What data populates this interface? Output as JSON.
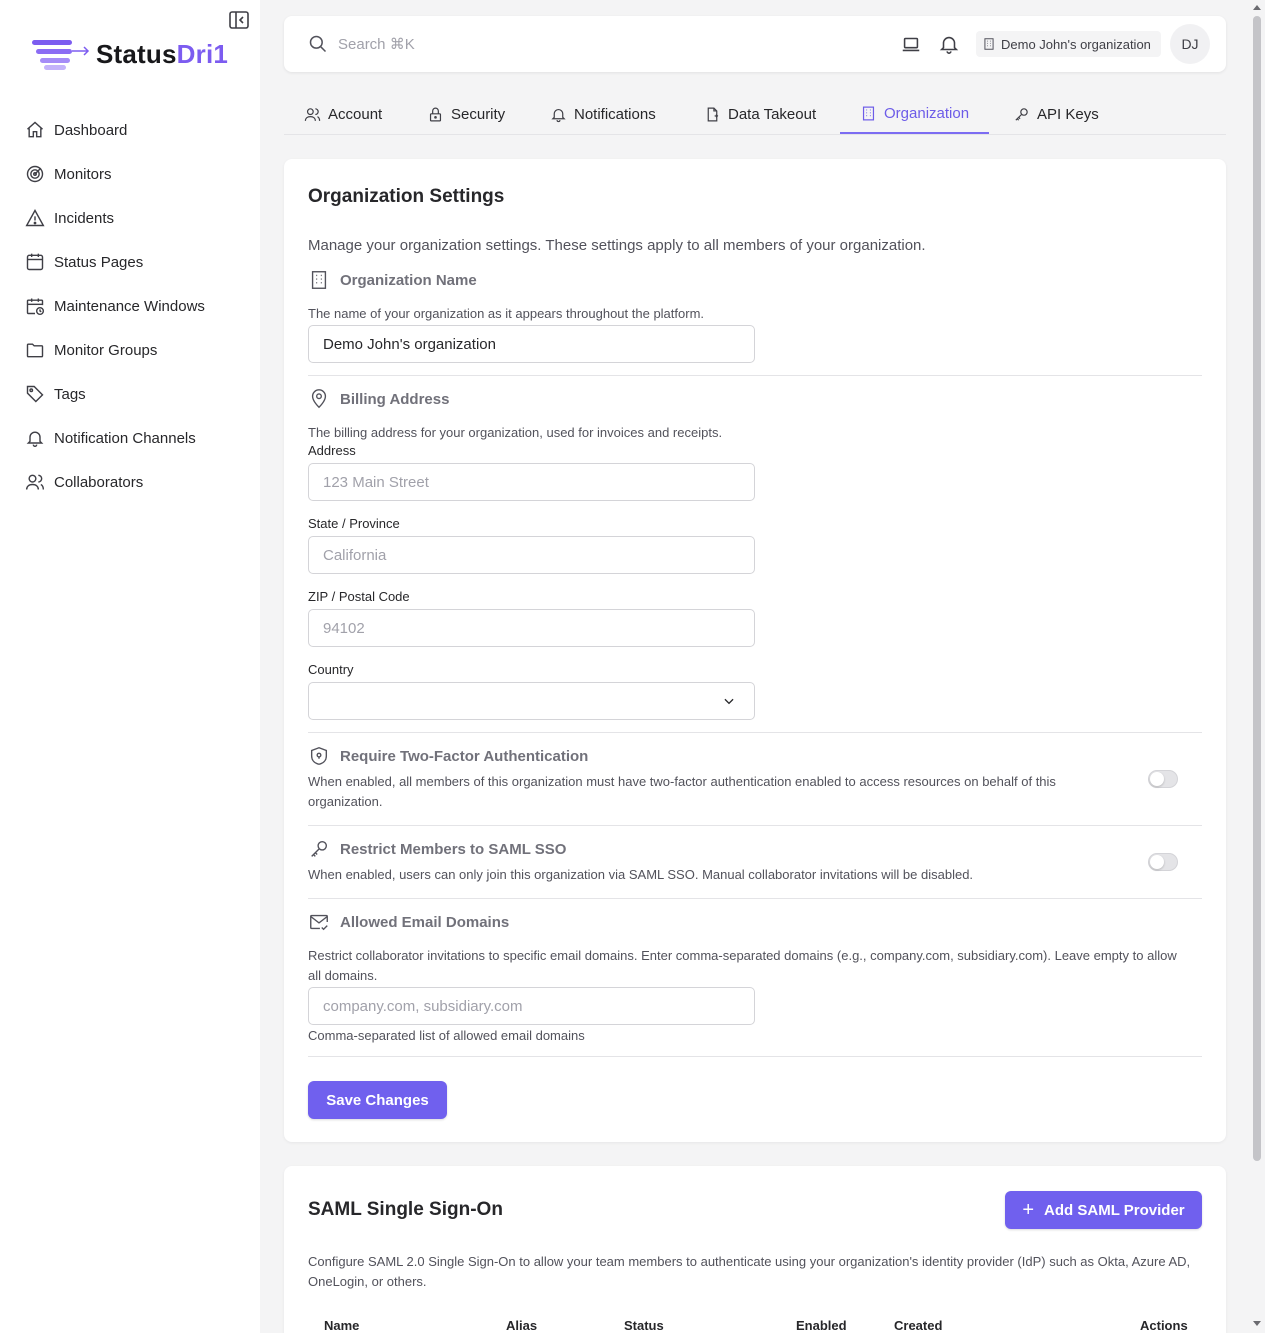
{
  "brand": {
    "name_part1": "Status",
    "name_part2": "Dri1",
    "accent_color": "#7c5cf0"
  },
  "sidebar": {
    "items": [
      {
        "label": "Dashboard",
        "icon": "home-icon"
      },
      {
        "label": "Monitors",
        "icon": "radar-icon"
      },
      {
        "label": "Incidents",
        "icon": "warning-icon"
      },
      {
        "label": "Status Pages",
        "icon": "page-icon"
      },
      {
        "label": "Maintenance Windows",
        "icon": "calendar-clock-icon"
      },
      {
        "label": "Monitor Groups",
        "icon": "folder-icon"
      },
      {
        "label": "Tags",
        "icon": "tag-icon"
      },
      {
        "label": "Notification Channels",
        "icon": "bell-icon"
      },
      {
        "label": "Collaborators",
        "icon": "users-icon"
      }
    ]
  },
  "header": {
    "search_placeholder": "Search ⌘K",
    "org_name": "Demo John's organization",
    "avatar_initials": "DJ"
  },
  "tabs": [
    {
      "label": "Account",
      "icon": "user-icon",
      "active": false
    },
    {
      "label": "Security",
      "icon": "lock-icon",
      "active": false
    },
    {
      "label": "Notifications",
      "icon": "bell-icon",
      "active": false
    },
    {
      "label": "Data Takeout",
      "icon": "file-export-icon",
      "active": false
    },
    {
      "label": "Organization",
      "icon": "building-icon",
      "active": true
    },
    {
      "label": "API Keys",
      "icon": "key-icon",
      "active": false
    }
  ],
  "org_settings": {
    "title": "Organization Settings",
    "description": "Manage your organization settings. These settings apply to all members of your organization.",
    "name_section": {
      "heading": "Organization Name",
      "help": "The name of your organization as it appears throughout the platform.",
      "value": "Demo John's organization"
    },
    "billing": {
      "heading": "Billing Address",
      "help": "The billing address for your organization, used for invoices and receipts.",
      "address_label": "Address",
      "address_placeholder": "123 Main Street",
      "state_label": "State / Province",
      "state_placeholder": "California",
      "zip_label": "ZIP / Postal Code",
      "zip_placeholder": "94102",
      "country_label": "Country",
      "country_value": ""
    },
    "two_factor": {
      "heading": "Require Two-Factor Authentication",
      "help": "When enabled, all members of this organization must have two-factor authentication enabled to access resources on behalf of this organization.",
      "enabled": false
    },
    "saml_restrict": {
      "heading": "Restrict Members to SAML SSO",
      "help": "When enabled, users can only join this organization via SAML SSO. Manual collaborator invitations will be disabled.",
      "enabled": false
    },
    "email_domains": {
      "heading": "Allowed Email Domains",
      "help": "Restrict collaborator invitations to specific email domains. Enter comma-separated domains (e.g., company.com, subsidiary.com). Leave empty to allow all domains.",
      "placeholder": "company.com, subsidiary.com",
      "hint": "Comma-separated list of allowed email domains"
    },
    "save_label": "Save Changes"
  },
  "saml": {
    "title": "SAML Single Sign-On",
    "add_label": "Add SAML Provider",
    "description": "Configure SAML 2.0 Single Sign-On to allow your team members to authenticate using your organization's identity provider (IdP) such as Okta, Azure AD, OneLogin, or others.",
    "columns": [
      "Name",
      "Alias",
      "Status",
      "Enabled",
      "Created",
      "Actions"
    ]
  }
}
